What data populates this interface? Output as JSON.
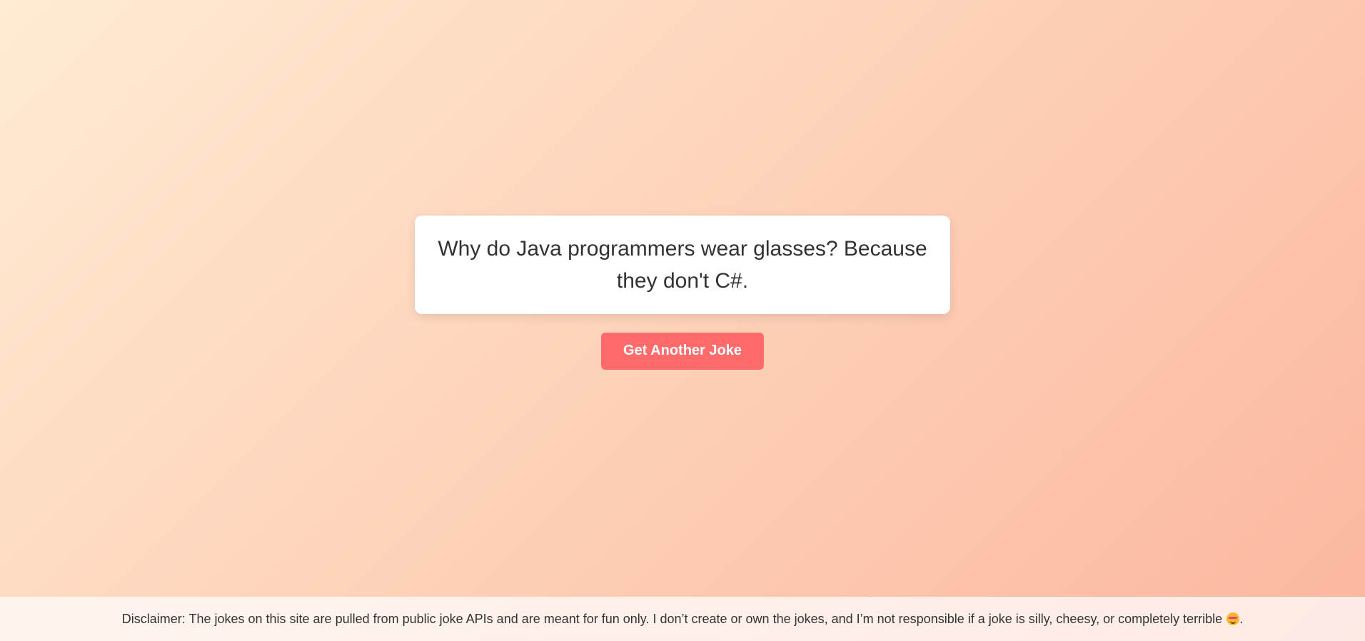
{
  "joke": {
    "text": "Why do Java programmers wear glasses? Because they don't C#."
  },
  "button": {
    "label": "Get Another Joke"
  },
  "footer": {
    "disclaimer": "Disclaimer: The jokes on this site are pulled from public joke APIs and are meant for fun only. I don’t create or own the jokes, and I’m not responsible if a joke is silly, cheesy, or completely terrible",
    "emoji_icon": "silly-face-emoji-icon",
    "end_punctuation": "."
  },
  "colors": {
    "background_start": "#ffecd2",
    "background_end": "#fcb69f",
    "button": "#ff6b6b",
    "card": "#ffffff",
    "text": "#333333"
  }
}
